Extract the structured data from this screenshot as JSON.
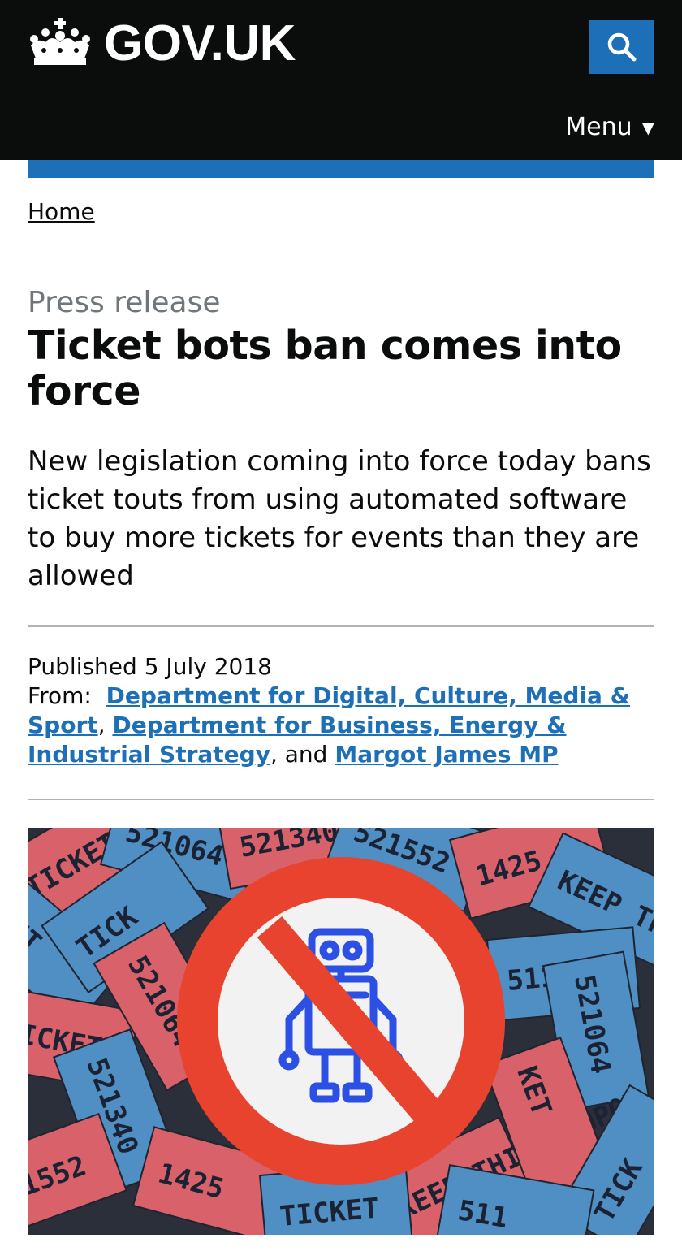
{
  "header": {
    "brand": "GOV.UK",
    "menu_label": "Menu",
    "menu_arrow": "▼",
    "search_icon": "search-icon",
    "crown_icon": "crown-icon",
    "colors": {
      "background": "#0b0c0c",
      "accent": "#1d70b8"
    }
  },
  "breadcrumb": {
    "home": "Home"
  },
  "article": {
    "caption": "Press release",
    "title": "Ticket bots ban comes into force",
    "lede": "New legislation coming into force today bans ticket touts from using automated software to buy more tickets for events than they are allowed"
  },
  "meta": {
    "published_label": "Published",
    "published_date": "5 July 2018",
    "from_label": "From:",
    "org1": "Department for Digital, Culture, Media & Sport",
    "sep1": ",",
    "org2": "Department for Business, Energy & Industrial Strategy",
    "sep2": ", and",
    "person": "Margot James MP"
  },
  "hero": {
    "ticket_texts": [
      "TICKET",
      "521064",
      "521340",
      "521552",
      "1425",
      "KEEP THIS COUPON",
      "KET",
      "TICK",
      "511"
    ],
    "colors": {
      "blue_ticket": "#4f8fc4",
      "red_ticket": "#d9626a",
      "ban_red": "#e8432e",
      "robot_blue": "#2b50e3"
    }
  }
}
